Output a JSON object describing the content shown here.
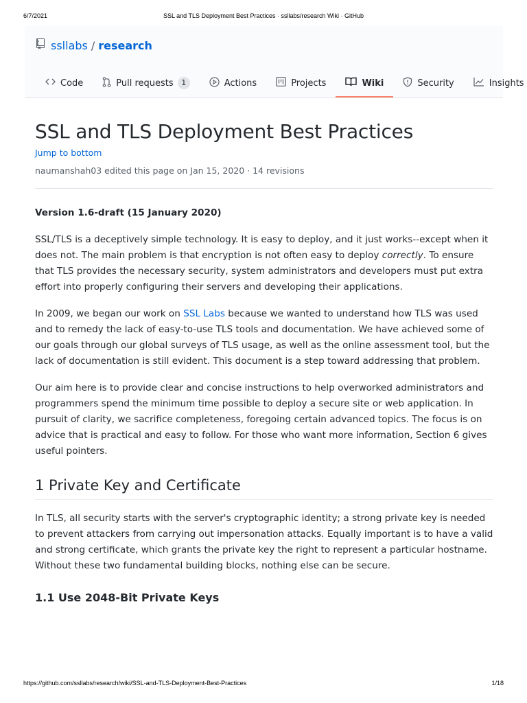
{
  "print_header": {
    "date": "6/7/2021",
    "title": "SSL and TLS Deployment Best Practices · ssllabs/research Wiki · GitHub"
  },
  "repo": {
    "owner": "ssllabs",
    "separator": "/",
    "name": "research"
  },
  "tabs": [
    {
      "label": "Code",
      "icon": "code-icon"
    },
    {
      "label": "Pull requests",
      "icon": "git-pull-request-icon",
      "counter": "1"
    },
    {
      "label": "Actions",
      "icon": "play-icon"
    },
    {
      "label": "Projects",
      "icon": "project-icon"
    },
    {
      "label": "Wiki",
      "icon": "book-icon",
      "selected": true
    },
    {
      "label": "Security",
      "icon": "shield-icon"
    },
    {
      "label": "Insights",
      "icon": "graph-icon"
    }
  ],
  "colors": {
    "link": "#0366d6",
    "selected_tab_underline": "#f9826c",
    "muted_text": "#586069"
  },
  "page": {
    "title": "SSL and TLS Deployment Best Practices",
    "jump_link": "Jump to bottom",
    "meta": "naumanshah03 edited this page on Jan 15, 2020 · 14 revisions"
  },
  "article": {
    "version": "Version 1.6-draft (15 January 2020)",
    "p1_before": "SSL/TLS is a deceptively simple technology. It is easy to deploy, and it just works--except when it does not. The main problem is that encryption is not often easy to deploy ",
    "p1_em": "correctly",
    "p1_after": ". To ensure that TLS provides the necessary security, system administrators and developers must put extra effort into properly configuring their servers and developing their applications.",
    "p2_before": "In 2009, we began our work on ",
    "p2_link": "SSL Labs",
    "p2_after": " because we wanted to understand how TLS was used and to remedy the lack of easy-to-use TLS tools and documentation. We have achieved some of our goals through our global surveys of TLS usage, as well as the online assessment tool, but the lack of documentation is still evident. This document is a step toward addressing that problem.",
    "p3": "Our aim here is to provide clear and concise instructions to help overworked administrators and programmers spend the minimum time possible to deploy a secure site or web application. In pursuit of clarity, we sacrifice completeness, foregoing certain advanced topics. The focus is on advice that is practical and easy to follow. For those who want more information, Section 6 gives useful pointers.",
    "h2_1": "1 Private Key and Certificate",
    "p4": "In TLS, all security starts with the server's cryptographic identity; a strong private key is needed to prevent attackers from carrying out impersonation attacks. Equally important is to have a valid and strong certificate, which grants the private key the right to represent a particular hostname. Without these two fundamental building blocks, nothing else can be secure.",
    "h3_1": "1.1 Use 2048-Bit Private Keys"
  },
  "print_footer": {
    "url": "https://github.com/ssllabs/research/wiki/SSL-and-TLS-Deployment-Best-Practices",
    "page": "1/18"
  }
}
